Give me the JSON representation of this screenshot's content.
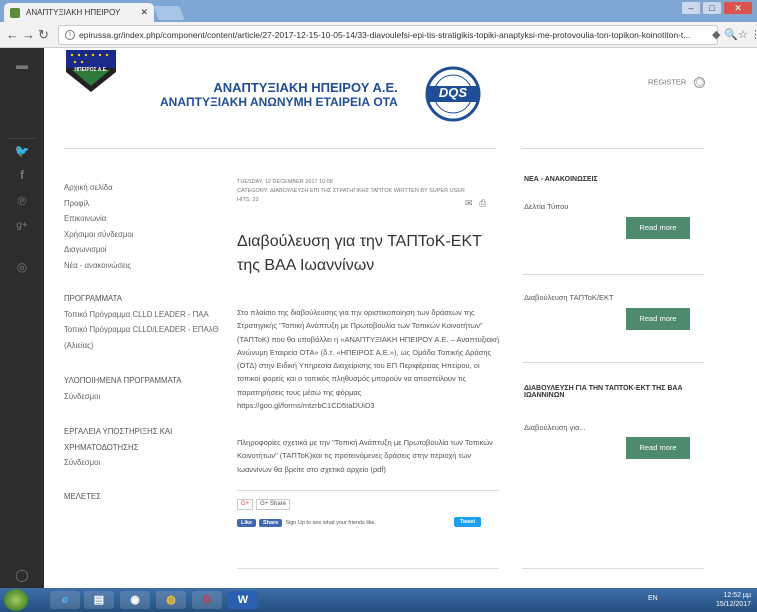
{
  "browser": {
    "tab_title": "ΑΝΑΠΤΥΞΙΑΚΗ ΗΠΕΙΡΟΥ",
    "url": "epirussa.gr/index.php/component/content/article/27-2017-12-15-10-05-14/33-diavoulefsi-epi-tis-stratigikis-topiki-anaptyksi-me-protovoulia-ton-topikon-koinotiton-t..."
  },
  "header": {
    "company_line1": "ΑΝΑΠΤΥΞΙΑΚΗ ΗΠΕΙΡΟΥ Α.Ε.",
    "company_line2": "ΑΝΑΠΤΥΞΙΑΚΗ ΑΝΩΝΥΜΗ ΕΤΑΙΡΕΙΑ ΟΤΑ",
    "logo_text": "ΗΠΕΙΡΟΣ Α.Ε.",
    "cert_logo_text": "DQS",
    "register_label": "REGISTER"
  },
  "leftnav": {
    "items": [
      "Αρχική σελίδα",
      "Προφίλ",
      "Επικοινωνία",
      "Χρήσιμοι σύνδεσμοι",
      "Διαγωνισμοί",
      "Νέα - ανακοινώσεις"
    ],
    "programs_head": "ΠΡΟΓΡΑΜΜΑΤΑ",
    "programs": [
      "Τοπικό Πρόγραμμα CLLD LEADER - ΠΑΑ",
      "Τοπικό Πρόγραμμα CLLD/LEADER - ΕΠΑλΘ",
      "(Αλιείας)"
    ],
    "implemented_head": "ΥΛΟΠΟΙΗΜΕΝΑ ΠΡΟΓΡΑΜΜΑΤΑ",
    "implemented": [
      "Σύνδεσμοι"
    ],
    "tools_head1": "ΕΡΓΑΛΕΙΑ ΥΠΟΣΤΗΡΙΞΗΣ ΚΑΙ",
    "tools_head2": "ΧΡΗΜΑΤΟΔΟΤΗΣΗΣ",
    "tools": [
      "Σύνδεσμοι"
    ],
    "studies_head": "ΜΕΛΕΤΕΣ"
  },
  "article": {
    "date": "TUESDAY, 12 DECEMBER 2017 10:08",
    "category": "CATEGORY: ΔΙΑΒΟΥΛΕΥΣΗ ΕΠΙ ΤΗΣ ΣΤΡΑΤΗΓΙΚΗΣ ΤΑΠΤΟΚ    WRITTEN BY SUPER USER",
    "hits": "HITS: 22",
    "title": "Διαβούλευση για την ΤΑΠΤοΚ-ΕΚΤ της ΒΑΑ Ιωαννίνων",
    "body1": "Στο πλαίσιο της διαβούλευσης για την οριστικοποίηση των δράσεων της Στρατηγικής \"Τοπική Ανάπτυξη με Πρωτοβουλία των Τοπικών Κοινοτήτων\" (ΤΑΠΤοΚ) που θα υποβάλλει η «ΑΝΑΠΤΥΞΙΑΚΗ ΗΠΕΙΡΟΥ Α.Ε. – Αναπτυξιακή Ανώνυμη Εταιρεία ΟΤΑ» (δ.τ. «ΗΠΕΙΡΟΣ Α.Ε.»), ως Ομάδα Τοπικής Δράσης (ΟΤΔ) στην Ειδική Υπηρεσία Διαχείρισης του ΕΠ Περιφέρειας Ηπείρου, οι τοπικοί φορείς και ο τοπικός πληθυσμός μπορούν να αποστείλουν τις παρατηρήσεις τους μέσω της φόρμας https://goo.gl/forms/mtzrbC1CD5taDUiD3",
    "body2": "Πληροφορίες σχετικά με την \"Τοπική Ανάπτυξη με Πρωτοβουλία των Τοπικών Κοινοτήτων\" (ΤΑΠΤοΚ)και τις προτεινόμενες δράσεις στην περιοχή των Ιωαννίνων θα βρείτε στο σχετικό αρχείο (pdf)",
    "share_g": "G+",
    "share_label": "G+ Share",
    "fb_like": "Like",
    "fb_share": "Share",
    "fb_text": "Sign Up to see what your friends like.",
    "tweet": "Tweet"
  },
  "right": {
    "news_head": "ΝΕΑ - ΑΝΑΚΟΙΝΩΣΕΙΣ",
    "press_label": "Δελτία Τύπου",
    "item2_label": "Διαβούλευση ΤΑΠΤοΚ/ΕΚΤ",
    "consult_head1": "ΔΙΑΒΟΥΛΕΥΣΗ ΓΙΑ ΤΗΝ ΤΑΠΤΟΚ-ΕΚΤ ΤΗΣ ΒΑΑ",
    "consult_head2": "ΙΩΑΝΝΙΝΩΝ",
    "consult_text": "Διαβούλευση για...",
    "read_more": "Read more"
  },
  "taskbar": {
    "lang": "EN",
    "time": "12:52 μμ",
    "date": "15/12/2017"
  }
}
